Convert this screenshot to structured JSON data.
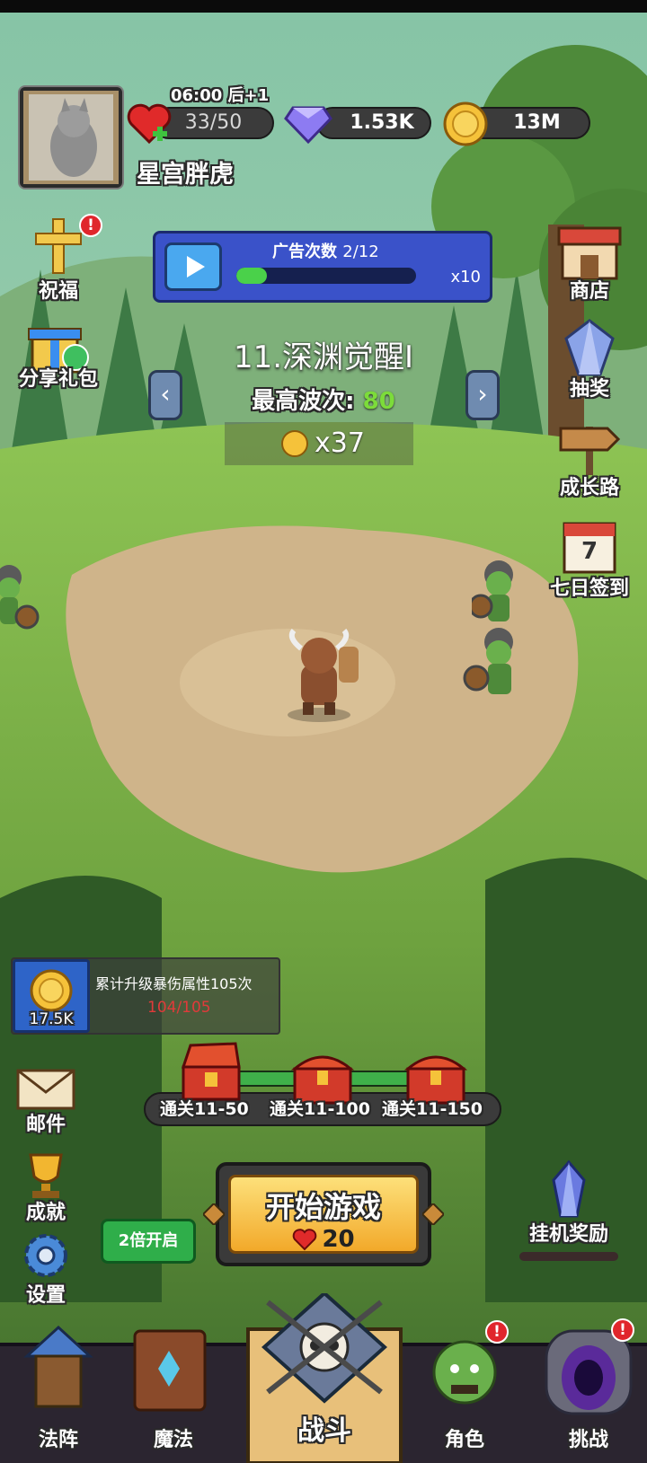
{
  "profile": {
    "name": "星宫胖虎",
    "timer": "06:00 后+1"
  },
  "resources": {
    "stamina": "33/50",
    "gems": "1.53K",
    "coins": "13M"
  },
  "ad_panel": {
    "title": "广告次数",
    "count": "2/12",
    "progress": 0.17,
    "multiplier": "x10"
  },
  "left_menu": {
    "bless": "祝福",
    "share_gift": "分享礼包"
  },
  "right_menu": {
    "shop": "商店",
    "lottery": "抽奖",
    "growth": "成长路",
    "checkin": "七日签到",
    "checkin_day": "7"
  },
  "stage": {
    "name": "11.深渊觉醒I",
    "best_wave_label": "最高波次:",
    "best_wave_value": "80",
    "reward": "x37"
  },
  "quest": {
    "icon_value": "17.5K",
    "text": "累计升级暴伤属性105次",
    "progress": "104/105"
  },
  "chests": [
    {
      "label": "通关11-50",
      "state": "open"
    },
    {
      "label": "通关11-100",
      "state": "closed"
    },
    {
      "label": "通关11-150",
      "state": "closed"
    }
  ],
  "side_buttons": {
    "mail": "邮件",
    "achievements": "成就",
    "settings": "设置",
    "double": "2倍开启"
  },
  "start": {
    "label": "开始游戏",
    "cost": "20"
  },
  "idle_reward": "挂机奖励",
  "nav": {
    "formation": "法阵",
    "magic": "魔法",
    "battle": "战斗",
    "character": "角色",
    "challenge": "挑战",
    "badge": "!"
  },
  "colors": {
    "accent_green": "#7cdc3a",
    "alert_red": "#e0262c",
    "gold": "#f5c23a"
  }
}
